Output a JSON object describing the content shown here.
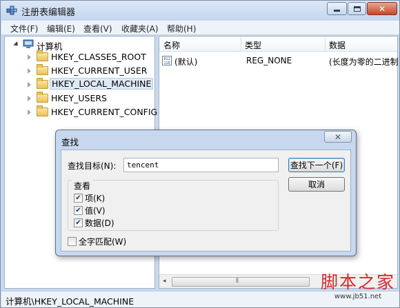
{
  "window": {
    "title": "注册表编辑器"
  },
  "menu": [
    "文件(F)",
    "编辑(E)",
    "查看(V)",
    "收藏夹(A)",
    "帮助(H)"
  ],
  "tree": {
    "root": "计算机",
    "items": [
      "HKEY_CLASSES_ROOT",
      "HKEY_CURRENT_USER",
      "HKEY_LOCAL_MACHINE",
      "HKEY_USERS",
      "HKEY_CURRENT_CONFIG"
    ],
    "selected": "HKEY_LOCAL_MACHINE"
  },
  "list": {
    "columns": [
      "名称",
      "类型",
      "数据"
    ],
    "rows": [
      {
        "name": "(默认)",
        "type": "REG_NONE",
        "data": "(长度为零的二进制"
      }
    ],
    "value_icon_text": "011\n110"
  },
  "status": {
    "path": "计算机\\HKEY_LOCAL_MACHINE"
  },
  "dialog": {
    "title": "查找",
    "find_label": "查找目标(N):",
    "find_value": "tencent",
    "find_next_label": "查找下一个(F)",
    "cancel_label": "取消",
    "look_at_title": "查看",
    "options": [
      {
        "label": "项(K)",
        "checked": true
      },
      {
        "label": "值(V)",
        "checked": true
      },
      {
        "label": "数据(D)",
        "checked": true
      }
    ],
    "match_whole": {
      "label": "全字匹配(W)",
      "checked": false
    }
  },
  "watermark": {
    "main": "脚本之家",
    "url": "www.jb51.net"
  },
  "icons": {
    "app": "registry-editor-icon",
    "computer": "computer-icon",
    "folder": "folder-icon"
  }
}
